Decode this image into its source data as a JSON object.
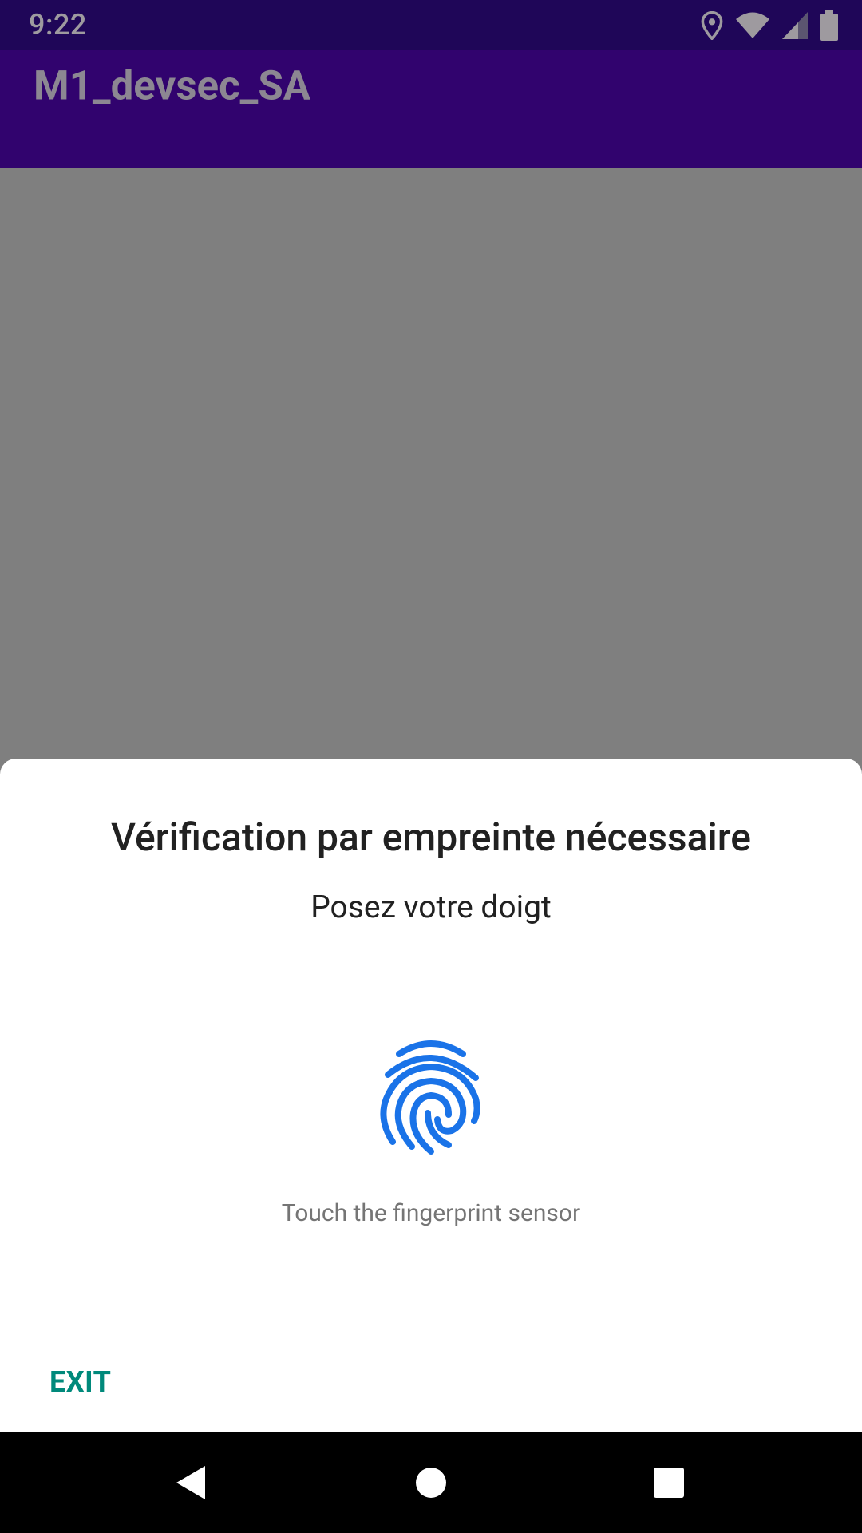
{
  "status_bar": {
    "time": "9:22",
    "icons": [
      "location-icon",
      "wifi-icon",
      "cellular-signal-icon",
      "battery-icon"
    ]
  },
  "app_bar": {
    "title": "M1_devsec_SA"
  },
  "biometric_prompt": {
    "title": "Vérification par empreinte nécessaire",
    "subtitle": "Posez votre doigt",
    "icon": "fingerprint-icon",
    "hint": "Touch the fingerprint sensor",
    "negative_button": "EXIT"
  },
  "nav_bar": {
    "icons": [
      "back-icon",
      "home-icon",
      "recents-icon"
    ]
  },
  "colors": {
    "status_bar_bg": "#1f0658",
    "app_bar_bg": "#31036e",
    "scrim": "#7f7f7f",
    "sheet_bg": "#ffffff",
    "fingerprint": "#1a73e8",
    "exit_button": "#00897b"
  }
}
